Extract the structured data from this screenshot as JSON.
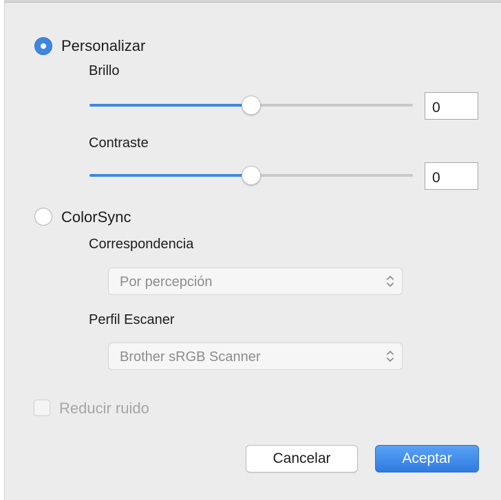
{
  "mode": {
    "custom": {
      "label": "Personalizar",
      "selected": true
    },
    "colorsync": {
      "label": "ColorSync",
      "selected": false
    }
  },
  "brightness": {
    "label": "Brillo",
    "value": "0",
    "slider_fraction": 0.5
  },
  "contrast": {
    "label": "Contraste",
    "value": "0",
    "slider_fraction": 0.5
  },
  "matching": {
    "label": "Correspondencia",
    "selected": "Por percepción",
    "enabled": false
  },
  "scanner_profile": {
    "label": "Perfil Escaner",
    "selected": "Brother sRGB Scanner",
    "enabled": false
  },
  "noise_reduction": {
    "label": "Reducir ruido",
    "checked": false,
    "enabled": false
  },
  "buttons": {
    "cancel": "Cancelar",
    "accept": "Aceptar"
  },
  "colors": {
    "accent": "#3d87e0",
    "disabled_text": "#a6a6a6",
    "background": "#ececec"
  }
}
